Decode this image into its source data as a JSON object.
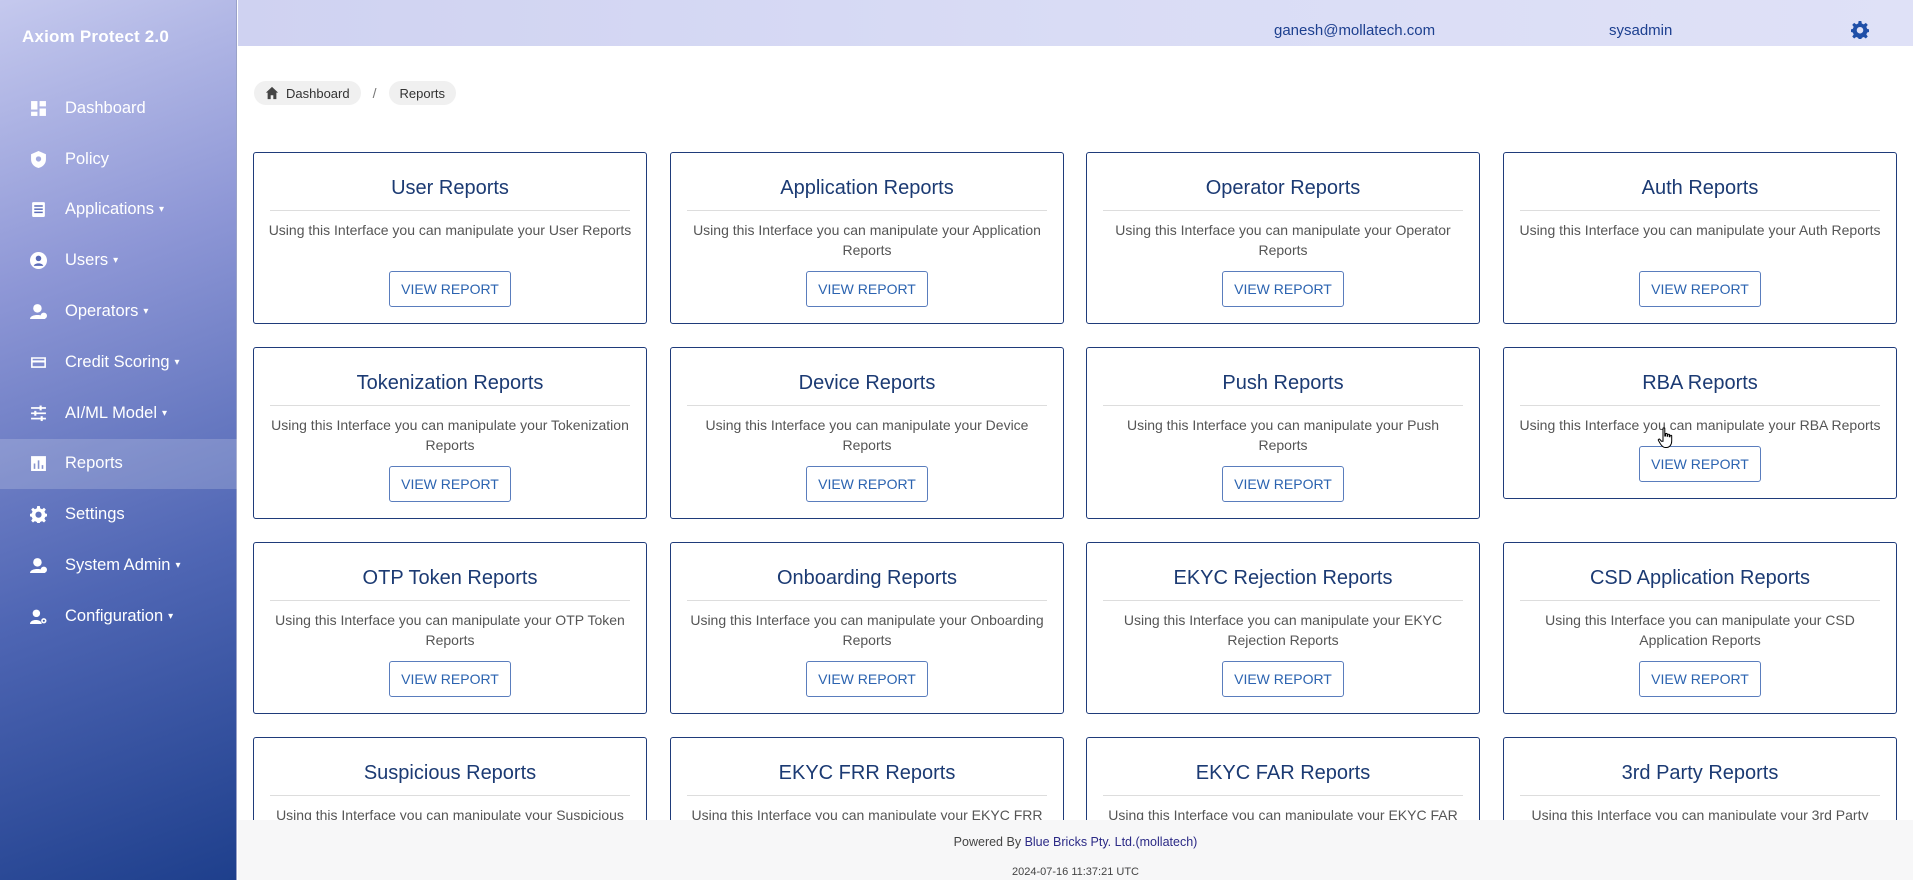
{
  "app": {
    "title": "Axiom Protect 2.0"
  },
  "sidebar": {
    "items": [
      {
        "label": "Dashboard",
        "icon": "dashboard-icon",
        "dropdown": false
      },
      {
        "label": "Policy",
        "icon": "shield-icon",
        "dropdown": false
      },
      {
        "label": "Applications",
        "icon": "list-icon",
        "dropdown": true
      },
      {
        "label": "Users",
        "icon": "user-circle-icon",
        "dropdown": true
      },
      {
        "label": "Operators",
        "icon": "operator-icon",
        "dropdown": true
      },
      {
        "label": "Credit Scoring",
        "icon": "credit-card-icon",
        "dropdown": true
      },
      {
        "label": "AI/ML Model",
        "icon": "sliders-icon",
        "dropdown": true
      },
      {
        "label": "Reports",
        "icon": "chart-icon",
        "dropdown": false,
        "active": true
      },
      {
        "label": "Settings",
        "icon": "gear-icon",
        "dropdown": false
      },
      {
        "label": "System Admin",
        "icon": "admin-icon",
        "dropdown": true
      },
      {
        "label": "Configuration",
        "icon": "user-gear-icon",
        "dropdown": true
      }
    ]
  },
  "header": {
    "email": "ganesh@mollatech.com",
    "username": "sysadmin",
    "settings_icon": "gear-icon"
  },
  "breadcrumb": {
    "home": "Dashboard",
    "separator": "/",
    "current": "Reports"
  },
  "reports": {
    "button_label": "VIEW REPORT",
    "cards": [
      {
        "title": "User Reports",
        "desc": "Using this Interface you can manipulate your User Reports"
      },
      {
        "title": "Application Reports",
        "desc": "Using this Interface you can manipulate your Application Reports"
      },
      {
        "title": "Operator Reports",
        "desc": "Using this Interface you can manipulate your Operator Reports"
      },
      {
        "title": "Auth Reports",
        "desc": "Using this Interface you can manipulate your Auth Reports"
      },
      {
        "title": "Tokenization Reports",
        "desc": "Using this Interface you can manipulate your Tokenization Reports"
      },
      {
        "title": "Device Reports",
        "desc": "Using this Interface you can manipulate your Device Reports"
      },
      {
        "title": "Push Reports",
        "desc": "Using this Interface you can manipulate your Push Reports"
      },
      {
        "title": "RBA Reports",
        "desc": "Using this Interface you can manipulate your RBA Reports"
      },
      {
        "title": "OTP Token Reports",
        "desc": "Using this Interface you can manipulate your OTP Token Reports"
      },
      {
        "title": "Onboarding Reports",
        "desc": "Using this Interface you can manipulate your Onboarding Reports"
      },
      {
        "title": "EKYC Rejection Reports",
        "desc": "Using this Interface you can manipulate your EKYC Rejection Reports"
      },
      {
        "title": "CSD Application Reports",
        "desc": "Using this Interface you can manipulate your CSD Application Reports"
      },
      {
        "title": "Suspicious Reports",
        "desc": "Using this Interface you can manipulate your Suspicious"
      },
      {
        "title": "EKYC FRR Reports",
        "desc": "Using this Interface you can manipulate your EKYC FRR"
      },
      {
        "title": "EKYC FAR Reports",
        "desc": "Using this Interface you can manipulate your EKYC FAR"
      },
      {
        "title": "3rd Party Reports",
        "desc": "Using this Interface you can manipulate your 3rd Party"
      }
    ]
  },
  "footer": {
    "powered_prefix": "Powered By",
    "company": "Blue Bricks Pty. Ltd.(mollatech)",
    "timestamp": "2024-07-16 11:37:21 UTC"
  }
}
